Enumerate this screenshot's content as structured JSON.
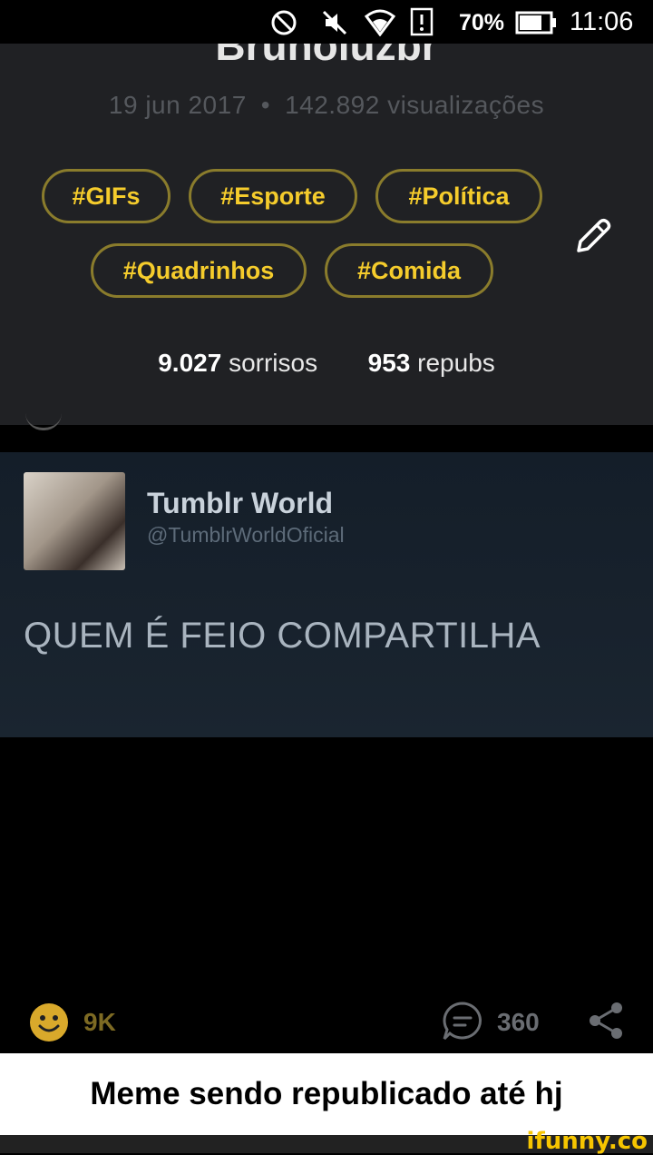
{
  "status_bar": {
    "battery": "70%",
    "time": "11:06"
  },
  "profile": {
    "username": "Brunoluzbr",
    "date": "19 jun 2017",
    "separator": "•",
    "views": "142.892 visualizações"
  },
  "tags": [
    "#GIFs",
    "#Esporte",
    "#Política",
    "#Quadrinhos",
    "#Comida"
  ],
  "stats": {
    "smiles_count": "9.027",
    "smiles_label": "sorrisos",
    "repubs_count": "953",
    "repubs_label": "repubs"
  },
  "tweet": {
    "name": "Tumblr World",
    "handle": "@TumblrWorldOficial",
    "text": "QUEM É FEIO COMPARTILHA"
  },
  "actions": {
    "likes": "9K",
    "comments": "360"
  },
  "caption": "Meme sendo republicado até hj",
  "watermark": "ifunny.co",
  "colors": {
    "tag_text": "#f5cc2c",
    "tag_border": "#8a7c2c",
    "panel_bg": "#202124",
    "smile_icon": "#d9a92b"
  }
}
